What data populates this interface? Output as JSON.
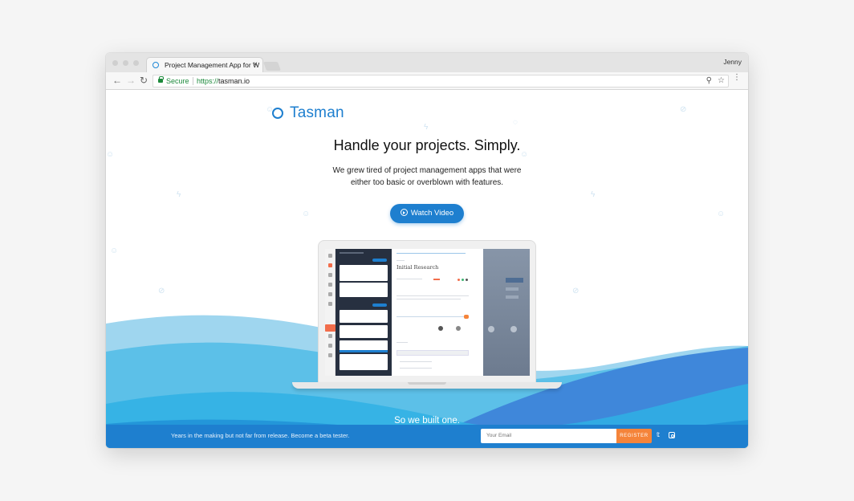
{
  "browser": {
    "tab_title": "Project Management App for W",
    "tab_close": "×",
    "user_name": "Jenny",
    "secure_label": "Secure",
    "url_protocol": "https://",
    "url_host": "tasman.io",
    "back": "←",
    "forward": "→",
    "reload": "↻",
    "search_glyph": "⚲",
    "star_glyph": "☆",
    "menu_glyph": "⋮"
  },
  "hero": {
    "brand": "Tasman",
    "headline": "Handle your projects. Simply.",
    "subline_1": "We grew tired of project management apps that were",
    "subline_2": "either too basic or overblown with features.",
    "cta_label": "Watch Video"
  },
  "app_preview": {
    "task_title": "Initial Research"
  },
  "section": {
    "tagline": "So we built one."
  },
  "signup": {
    "message": "Years in the making but not far from release. Become a beta tester.",
    "email_placeholder": "Your Email",
    "register_label": "REGISTER"
  },
  "social": {
    "twitter_glyph": "𝕥",
    "twitter_icon": "twitter-icon",
    "instagram_icon": "instagram-icon"
  },
  "colors": {
    "brand": "#1e7fcf",
    "register": "#f5843a",
    "secure": "#1d8a3c"
  }
}
